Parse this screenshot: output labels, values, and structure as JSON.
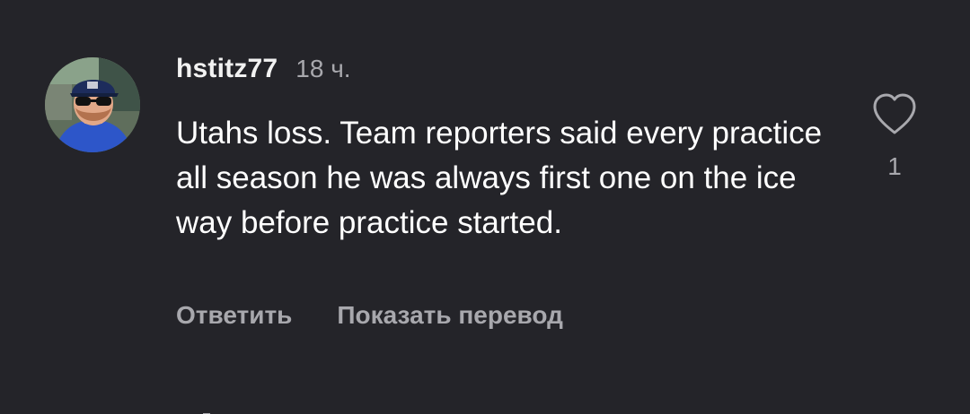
{
  "comment": {
    "username": "hstitz77",
    "time": "18 ч.",
    "text": "Utahs loss. Team reporters said every practice all season he was always first one on the ice way before practice started.",
    "likes": "1",
    "actions": {
      "reply": "Ответить",
      "translate": "Показать перевод"
    },
    "icons": {
      "like": "heart-outline-icon",
      "avatar": "user-avatar"
    }
  },
  "colors": {
    "background": "#242429",
    "text": "#ffffff",
    "secondary_text": "#a8a8ad"
  }
}
